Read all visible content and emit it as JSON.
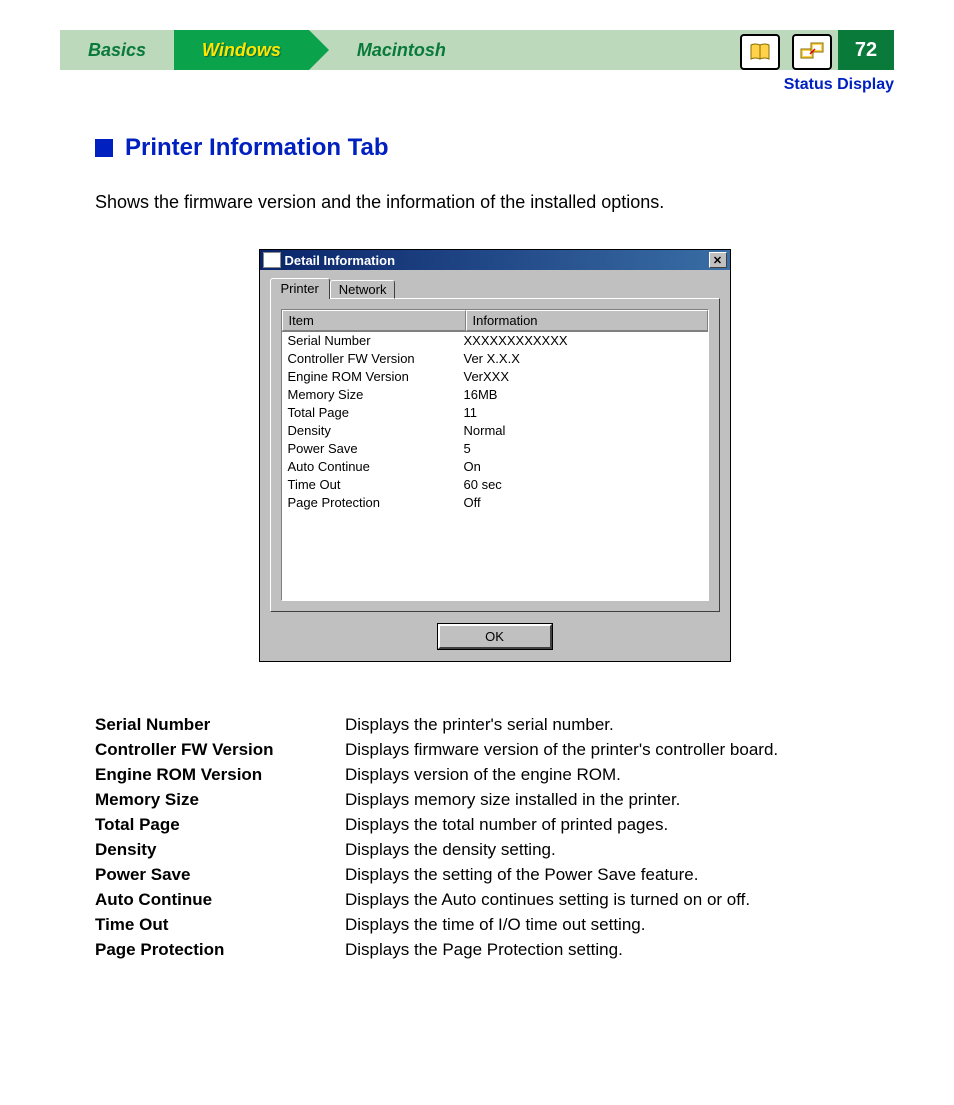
{
  "nav": {
    "tabs": [
      "Basics",
      "Windows",
      "Macintosh"
    ],
    "active_index": 1,
    "page_number": "72",
    "icons": [
      "book-icon",
      "network-pc-icon"
    ]
  },
  "breadcrumb": "Status Display",
  "section": {
    "title": "Printer Information Tab",
    "intro": "Shows the firmware version and the information of the installed options."
  },
  "dialog": {
    "title": "Detail Information",
    "tabs": [
      "Printer",
      "Network"
    ],
    "active_tab": 0,
    "columns": [
      "Item",
      "Information"
    ],
    "rows": [
      {
        "item": "Serial Number",
        "info": "XXXXXXXXXXXX"
      },
      {
        "item": "Controller FW Version",
        "info": "Ver X.X.X"
      },
      {
        "item": "Engine ROM Version",
        "info": "VerXXX"
      },
      {
        "item": "Memory Size",
        "info": "16MB"
      },
      {
        "item": "Total Page",
        "info": "11"
      },
      {
        "item": "Density",
        "info": "Normal"
      },
      {
        "item": "Power Save",
        "info": "5"
      },
      {
        "item": "Auto Continue",
        "info": "On"
      },
      {
        "item": "Time Out",
        "info": "60 sec"
      },
      {
        "item": "Page Protection",
        "info": "Off"
      }
    ],
    "ok_label": "OK"
  },
  "definitions": [
    {
      "term": "Serial Number",
      "desc": "Displays the printer's serial number."
    },
    {
      "term": "Controller FW Version",
      "desc": "Displays firmware version of the printer's controller board."
    },
    {
      "term": "Engine ROM Version",
      "desc": "Displays version of the engine ROM."
    },
    {
      "term": "Memory Size",
      "desc": "Displays memory size installed in the printer."
    },
    {
      "term": "Total Page",
      "desc": "Displays the total number of printed pages."
    },
    {
      "term": "Density",
      "desc": "Displays the density setting."
    },
    {
      "term": "Power Save",
      "desc": "Displays the setting of the Power Save feature."
    },
    {
      "term": "Auto Continue",
      "desc": "Displays the Auto continues setting is turned on or off."
    },
    {
      "term": "Time Out",
      "desc": "Displays the time of I/O time out setting."
    },
    {
      "term": "Page Protection",
      "desc": "Displays the Page Protection setting."
    }
  ]
}
